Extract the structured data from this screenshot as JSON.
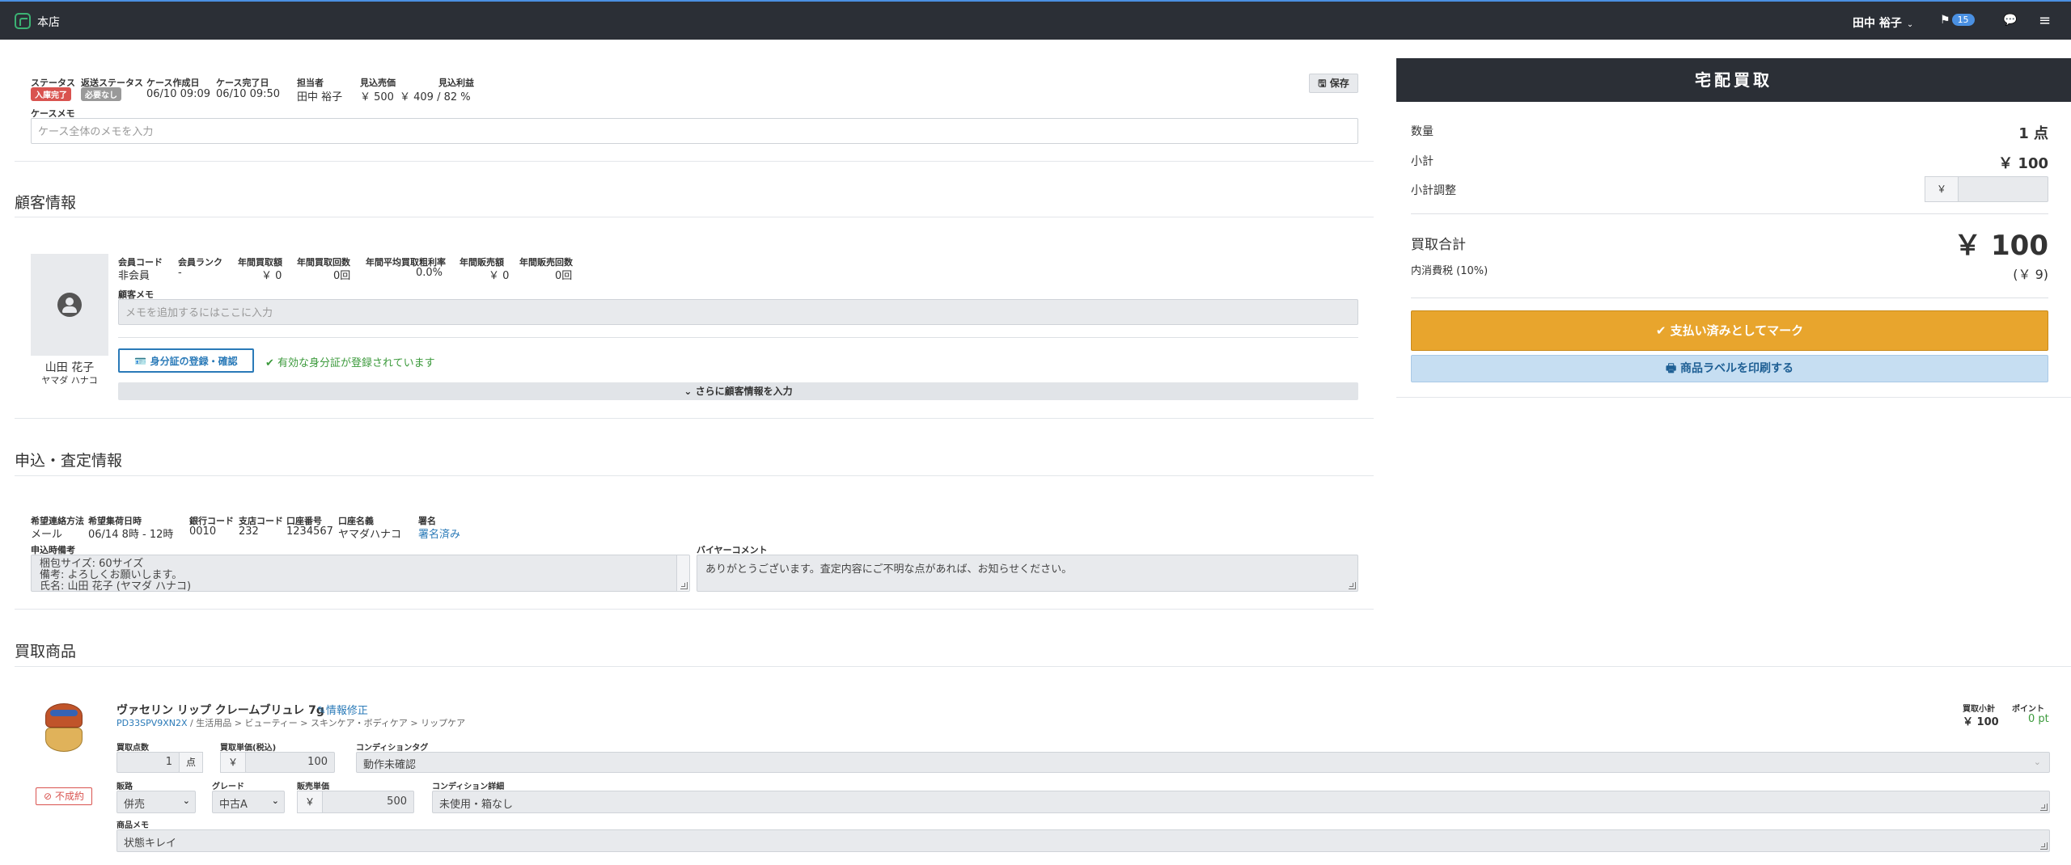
{
  "topbar": {
    "store": "本店",
    "user": "田中 裕子",
    "flag_count": "15"
  },
  "case": {
    "status_label": "ステータス",
    "status_value": "入庫完了",
    "return_label": "返送ステータス",
    "return_value": "必要なし",
    "created_label": "ケース作成日",
    "created_value": "06/10 09:09",
    "completed_label": "ケース完了日",
    "completed_value": "06/10 09:50",
    "staff_label": "担当者",
    "staff_value": "田中 裕子",
    "expected_sales_label": "見込売価",
    "expected_sales_value": "￥ 500",
    "expected_profit_label": "見込利益",
    "expected_profit_value": "￥ 409 / 82 %",
    "save_button": "保存",
    "memo_label": "ケースメモ",
    "memo_placeholder": "ケース全体のメモを入力"
  },
  "customer": {
    "section_title": "顧客情報",
    "name": "山田 花子",
    "kana": "ヤマダ ハナコ",
    "member_code_label": "会員コード",
    "member_code_value": "非会員",
    "rank_label": "会員ランク",
    "rank_value": "-",
    "annual_buy_amount_label": "年間買取額",
    "annual_buy_amount_value": "￥ 0",
    "annual_buy_count_label": "年間買取回数",
    "annual_buy_count_value": "0回",
    "annual_margin_label": "年間平均買取粗利率",
    "annual_margin_value": "0.0%",
    "annual_sales_amount_label": "年間販売額",
    "annual_sales_amount_value": "￥ 0",
    "annual_sales_count_label": "年間販売回数",
    "annual_sales_count_value": "0回",
    "memo_label": "顧客メモ",
    "memo_placeholder": "メモを追加するにはここに入力",
    "id_button": "身分証の登録・確認",
    "id_status": "有効な身分証が登録されています",
    "more_button": "さらに顧客情報を入力"
  },
  "application": {
    "section_title": "申込・査定情報",
    "contact_label": "希望連絡方法",
    "contact_value": "メール",
    "pickup_label": "希望集荷日時",
    "pickup_value": "06/14 8時 - 12時",
    "bank_label": "銀行コード",
    "bank_value": "0010",
    "branch_label": "支店コード",
    "branch_value": "232",
    "account_label": "口座番号",
    "account_value": "1234567",
    "account_name_label": "口座名義",
    "account_name_value": "ヤマダハナコ",
    "signature_label": "署名",
    "signature_value": "署名済み",
    "notes_label": "申込時備考",
    "notes_lines": [
      "梱包サイズ: 60サイズ",
      "備考: よろしくお願いします。",
      "氏名: 山田 花子 (ヤマダ ハナコ)"
    ],
    "buyer_comment_label": "バイヤーコメント",
    "buyer_comment_value": "ありがとうございます。査定内容にご不明な点があれば、お知らせください。"
  },
  "products": {
    "section_title": "買取商品",
    "item": {
      "name": "ヴァセリン リップ クレームブリュレ 7g",
      "edit_link": "情報修正",
      "code": "PD33SPV9XN2X",
      "category": " / 生活用品 > ビューティー > スキンケア・ボディケア > リップケア",
      "cancel_button": "不成約",
      "qty_label": "買取点数",
      "qty_value": "1",
      "qty_unit": "点",
      "price_label": "買取単価(税込)",
      "yen": "￥",
      "price_value": "100",
      "condition_tag_label": "コンディションタグ",
      "condition_tag_value": "動作未確認",
      "channel_label": "販路",
      "channel_value": "併売",
      "grade_label": "グレード",
      "grade_value": "中古A",
      "sale_price_label": "販売単価",
      "sale_price_value": "500",
      "condition_detail_label": "コンディション詳細",
      "condition_detail_value": "未使用・箱なし",
      "memo_label": "商品メモ",
      "memo_value": "状態キレイ",
      "subtotal_label": "買取小計",
      "subtotal_value": "￥ 100",
      "points_label": "ポイント",
      "points_value": "0 pt"
    }
  },
  "summary": {
    "title": "宅配買取",
    "qty_label": "数量",
    "qty_value": "1 点",
    "subtotal_label": "小計",
    "subtotal_value": "￥ 100",
    "adjust_label": "小計調整",
    "adjust_yen": "￥",
    "total_label": "買取合計",
    "total_value": "￥ 100",
    "tax_label": "内消費税 (10%)",
    "tax_value": "(￥ 9)",
    "mark_paid_button": "支払い済みとしてマーク",
    "print_label_button": "商品ラベルを印刷する"
  },
  "colors": {
    "topbar": "#2b2f36",
    "accent_blue": "#4a90e2",
    "paid_button": "#e8a52d",
    "print_button": "#c6def2",
    "status_red": "#d9534f",
    "success_green": "#3c9a3c"
  }
}
